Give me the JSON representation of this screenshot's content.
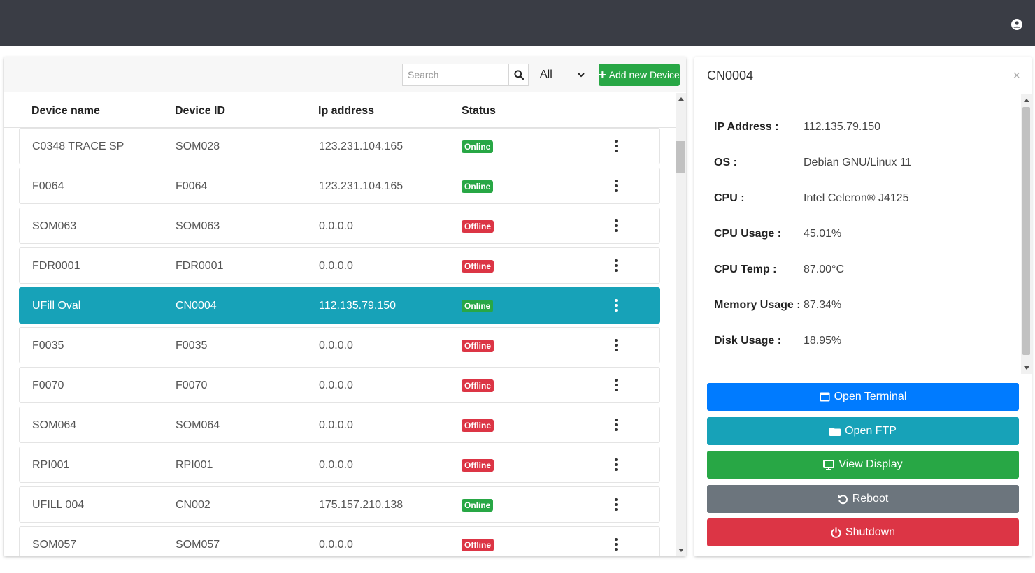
{
  "toolbar": {
    "search_placeholder": "Search",
    "filter_value": "All",
    "add_label": "Add new Device"
  },
  "table": {
    "headers": {
      "name": "Device name",
      "id": "Device ID",
      "ip": "Ip address",
      "status": "Status"
    },
    "rows": [
      {
        "name": "C0348 TRACE SP",
        "id": "SOM028",
        "ip": "123.231.104.165",
        "status": "Online"
      },
      {
        "name": "F0064",
        "id": "F0064",
        "ip": "123.231.104.165",
        "status": "Online"
      },
      {
        "name": "SOM063",
        "id": "SOM063",
        "ip": "0.0.0.0",
        "status": "Offline"
      },
      {
        "name": "FDR0001",
        "id": "FDR0001",
        "ip": "0.0.0.0",
        "status": "Offline"
      },
      {
        "name": "UFill Oval",
        "id": "CN0004",
        "ip": "112.135.79.150",
        "status": "Online"
      },
      {
        "name": "F0035",
        "id": "F0035",
        "ip": "0.0.0.0",
        "status": "Offline"
      },
      {
        "name": "F0070",
        "id": "F0070",
        "ip": "0.0.0.0",
        "status": "Offline"
      },
      {
        "name": "SOM064",
        "id": "SOM064",
        "ip": "0.0.0.0",
        "status": "Offline"
      },
      {
        "name": "RPI001",
        "id": "RPI001",
        "ip": "0.0.0.0",
        "status": "Offline"
      },
      {
        "name": "UFILL 004",
        "id": "CN002",
        "ip": "175.157.210.138",
        "status": "Online"
      },
      {
        "name": "SOM057",
        "id": "SOM057",
        "ip": "0.0.0.0",
        "status": "Offline"
      }
    ],
    "selected_index": 4
  },
  "detail": {
    "title": "CN0004",
    "close": "×",
    "fields": [
      {
        "label": "IP Address :",
        "value": "112.135.79.150"
      },
      {
        "label": "OS :",
        "value": "Debian GNU/Linux 11"
      },
      {
        "label": "CPU :",
        "value": "Intel Celeron® J4125"
      },
      {
        "label": "CPU Usage :",
        "value": "45.01%"
      },
      {
        "label": "CPU Temp :",
        "value": "87.00°C"
      },
      {
        "label": "Memory Usage :",
        "value": "87.34%"
      },
      {
        "label": "Disk Usage :",
        "value": "18.95%"
      }
    ],
    "actions": {
      "terminal": "Open Terminal",
      "ftp": "Open FTP",
      "display": "View Display",
      "reboot": "Reboot",
      "shutdown": "Shutdown"
    }
  },
  "colors": {
    "topbar": "#3a3d45",
    "online": "#28a745",
    "offline": "#dc3545",
    "selected_row": "#17a2b8",
    "primary": "#007bff",
    "secondary": "#6c757d"
  }
}
